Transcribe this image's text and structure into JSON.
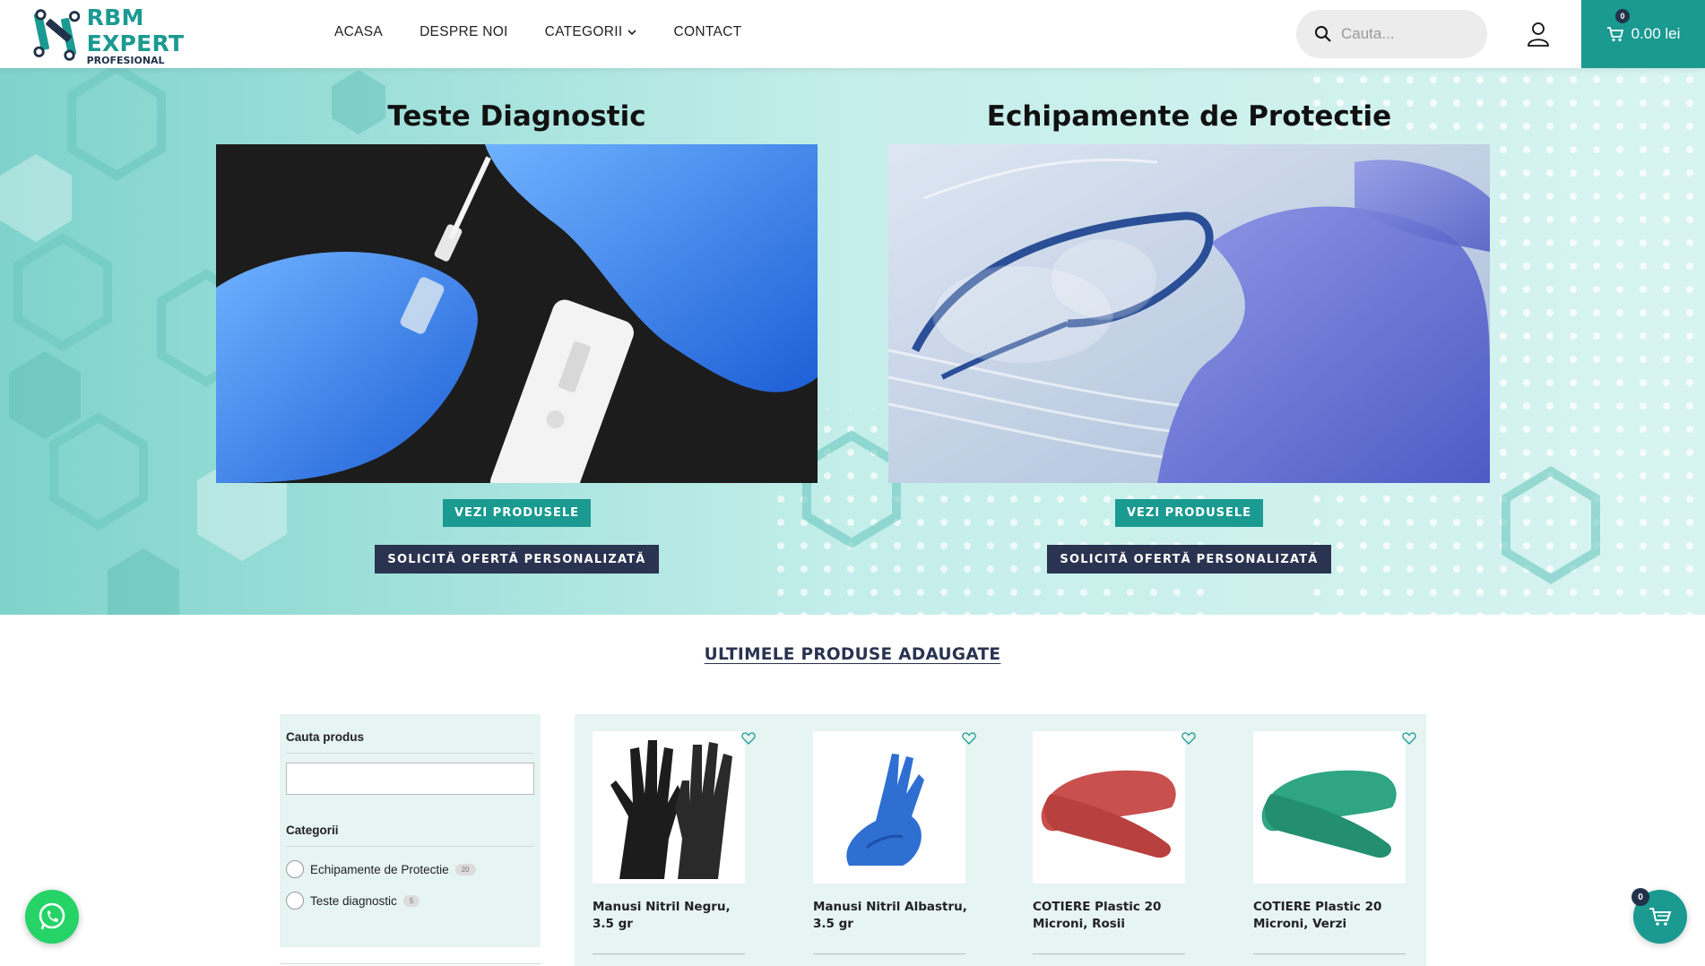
{
  "header": {
    "logo_title": "RBM EXPERT",
    "logo_subtitle": "PROFESIONAL",
    "nav": [
      {
        "label": "ACASA"
      },
      {
        "label": "DESPRE NOI"
      },
      {
        "label": "CATEGORII"
      },
      {
        "label": "CONTACT"
      }
    ],
    "search_placeholder": "Cauta...",
    "cart_count": "0",
    "cart_total": "0.00 lei"
  },
  "hero": {
    "cards": [
      {
        "title": "Teste Diagnostic",
        "btn_products": "VEZI PRODUSELE",
        "btn_offer": "SOLICITĂ OFERTĂ PERSONALIZATĂ"
      },
      {
        "title": "Echipamente de Protectie",
        "btn_products": "VEZI PRODUSELE",
        "btn_offer": "SOLICITĂ OFERTĂ PERSONALIZATĂ"
      }
    ]
  },
  "section_title": "ULTIMELE PRODUSE ADAUGATE",
  "sidebar": {
    "search_heading": "Cauta produs",
    "categories_heading": "Categorii",
    "categories": [
      {
        "label": "Echipamente de Protectie",
        "count": "20"
      },
      {
        "label": "Teste diagnostic",
        "count": "5"
      }
    ]
  },
  "products": [
    {
      "name": "Manusi Nitril Negru, 3.5 gr"
    },
    {
      "name": "Manusi Nitril Albastru, 3.5 gr"
    },
    {
      "name": "COTIERE Plastic 20 Microni, Rosii"
    },
    {
      "name": "COTIERE Plastic 20 Microni, Verzi"
    }
  ],
  "floating": {
    "cart_count": "0"
  },
  "colors": {
    "accent": "#1a9a90",
    "dark": "#2a3350",
    "hero_bg": "#aee6e1",
    "panel_bg": "#e6f4f2"
  }
}
